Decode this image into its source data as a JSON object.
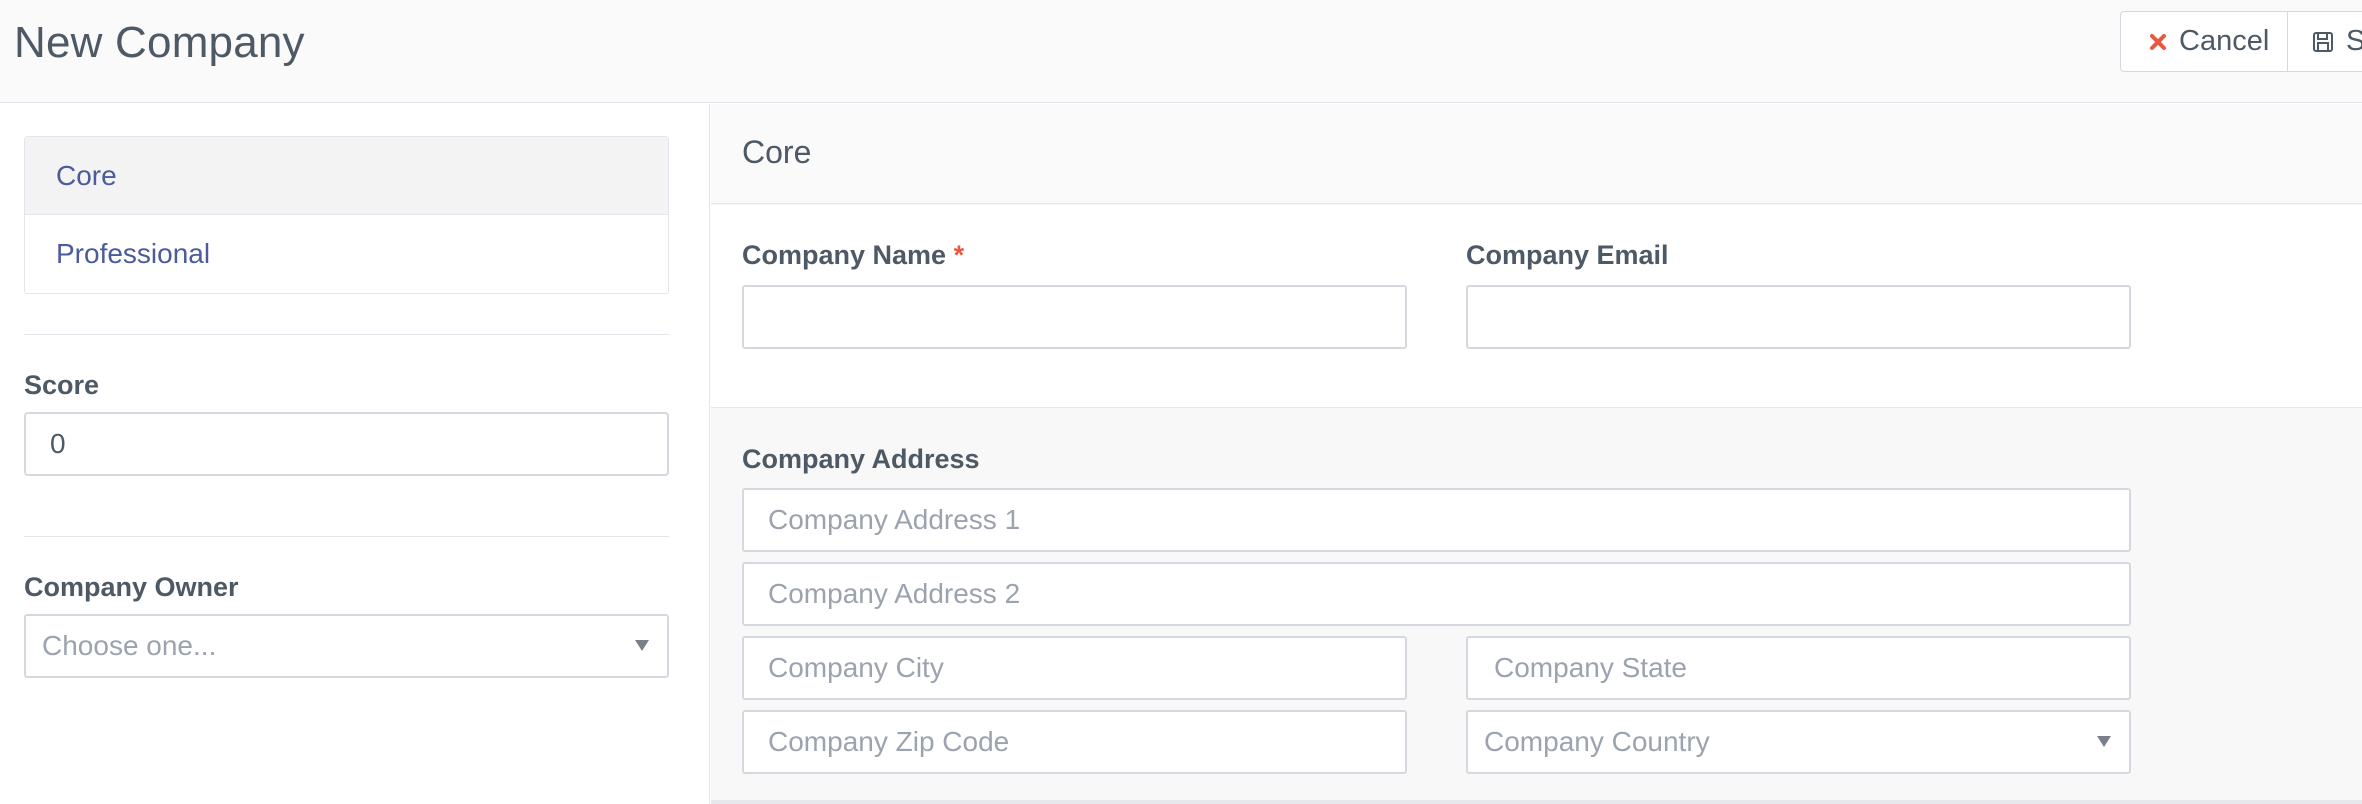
{
  "header": {
    "title": "New Company",
    "cancel_label": "Cancel",
    "save_label": "Sa"
  },
  "sidebar": {
    "nav": [
      {
        "label": "Core",
        "active": true
      },
      {
        "label": "Professional",
        "active": false
      }
    ],
    "score": {
      "label": "Score",
      "value": "0"
    },
    "owner": {
      "label": "Company Owner",
      "placeholder": "Choose one..."
    }
  },
  "main": {
    "section_title": "Core",
    "company_name": {
      "label": "Company Name",
      "required_mark": "*",
      "value": ""
    },
    "company_email": {
      "label": "Company Email",
      "value": ""
    },
    "address": {
      "label": "Company Address",
      "address1_placeholder": "Company Address 1",
      "address2_placeholder": "Company Address 2",
      "city_placeholder": "Company City",
      "state_placeholder": "Company State",
      "zip_placeholder": "Company Zip Code",
      "country_placeholder": "Company Country"
    }
  },
  "colors": {
    "accent_link": "#4b5b9b",
    "required": "#e9573f",
    "cancel_icon": "#e9573f"
  },
  "icons": {
    "cancel": "close-icon",
    "save": "floppy-disk-icon",
    "select_caret": "caret-down-icon"
  }
}
